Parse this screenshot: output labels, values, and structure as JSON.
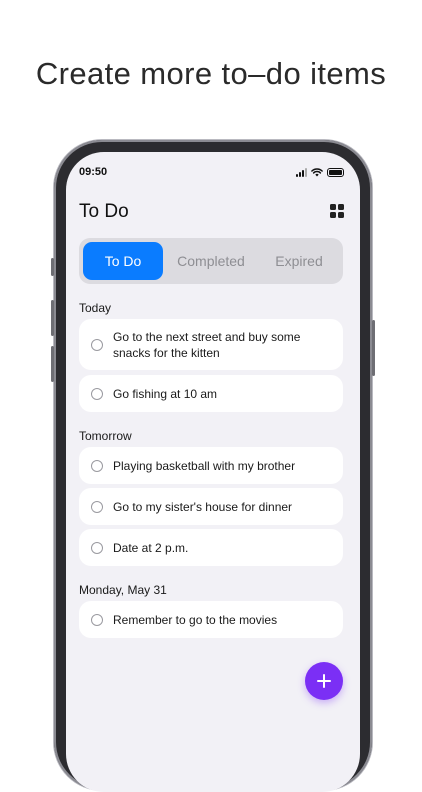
{
  "headline": "Create more to–do items",
  "status_bar": {
    "time": "09:50"
  },
  "header": {
    "title": "To Do",
    "menu_icon": "grid-icon"
  },
  "tabs": [
    {
      "label": "To Do",
      "active": true
    },
    {
      "label": "Completed",
      "active": false
    },
    {
      "label": "Expired",
      "active": false
    }
  ],
  "sections": [
    {
      "heading": "Today",
      "items": [
        {
          "text": "Go to the next street and buy some snacks for the kitten"
        },
        {
          "text": "Go fishing at 10 am"
        }
      ]
    },
    {
      "heading": "Tomorrow",
      "items": [
        {
          "text": "Playing basketball with my brother"
        },
        {
          "text": "Go to my sister's house for dinner"
        },
        {
          "text": "Date at 2 p.m."
        }
      ]
    },
    {
      "heading": "Monday, May 31",
      "items": [
        {
          "text": "Remember to go to the movies"
        }
      ]
    }
  ],
  "fab": {
    "icon": "plus-icon"
  },
  "colors": {
    "accent": "#0a7cff",
    "fab": "#7b2ff5",
    "screen_bg": "#f2f1f6"
  }
}
